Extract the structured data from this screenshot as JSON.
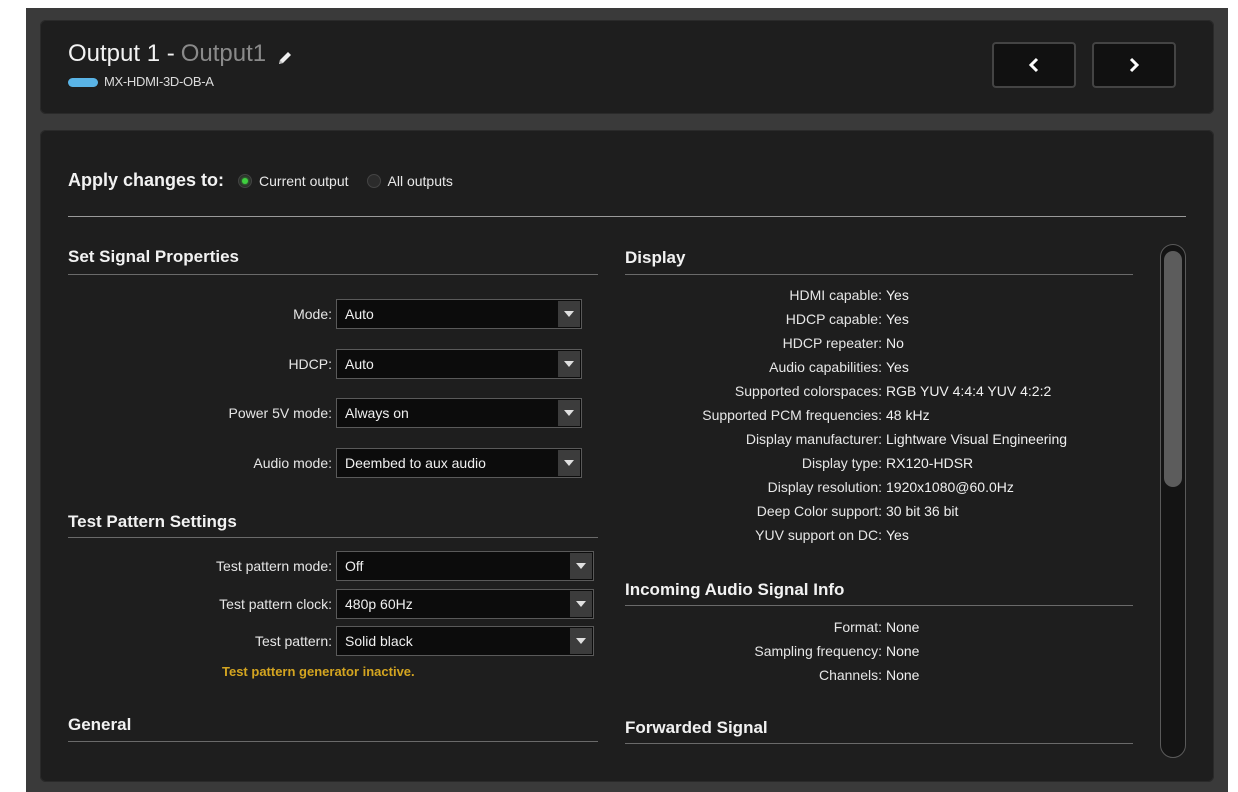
{
  "header": {
    "title_prefix": "Output 1 -",
    "output_name": "Output1",
    "device_model": "MX-HDMI-3D-OB-A"
  },
  "apply": {
    "label": "Apply changes to:",
    "options": [
      "Current output",
      "All outputs"
    ],
    "selected": "Current output"
  },
  "signal": {
    "title": "Set Signal Properties",
    "rows": [
      {
        "label": "Mode:",
        "value": "Auto"
      },
      {
        "label": "HDCP:",
        "value": "Auto"
      },
      {
        "label": "Power 5V mode:",
        "value": "Always on"
      },
      {
        "label": "Audio mode:",
        "value": "Deembed to aux audio"
      }
    ]
  },
  "test_pattern": {
    "title": "Test Pattern Settings",
    "rows": [
      {
        "label": "Test pattern mode:",
        "value": "Off"
      },
      {
        "label": "Test pattern clock:",
        "value": "480p 60Hz"
      },
      {
        "label": "Test pattern:",
        "value": "Solid black"
      }
    ],
    "warning": "Test pattern generator inactive."
  },
  "general": {
    "title": "General"
  },
  "display": {
    "title": "Display",
    "rows": [
      {
        "key": "HDMI capable:",
        "value": "Yes"
      },
      {
        "key": "HDCP capable:",
        "value": "Yes"
      },
      {
        "key": "HDCP repeater:",
        "value": "No"
      },
      {
        "key": "Audio capabilities:",
        "value": "Yes"
      },
      {
        "key": "Supported colorspaces:",
        "value": "RGB YUV 4:4:4 YUV 4:2:2"
      },
      {
        "key": "Supported PCM frequencies:",
        "value": "48 kHz"
      },
      {
        "key": "Display manufacturer:",
        "value": "Lightware Visual Engineering"
      },
      {
        "key": "Display type:",
        "value": "RX120-HDSR"
      },
      {
        "key": "Display resolution:",
        "value": "1920x1080@60.0Hz"
      },
      {
        "key": "Deep Color support:",
        "value": "30 bit 36 bit"
      },
      {
        "key": "YUV support on DC:",
        "value": "Yes"
      }
    ]
  },
  "audio_info": {
    "title": "Incoming Audio Signal Info",
    "rows": [
      {
        "key": "Format:",
        "value": "None"
      },
      {
        "key": "Sampling frequency:",
        "value": "None"
      },
      {
        "key": "Channels:",
        "value": "None"
      }
    ]
  },
  "forwarded": {
    "title": "Forwarded Signal"
  },
  "colors": {
    "accent_green": "#3fcf3f",
    "warning": "#d4a520",
    "device_pill": "#5ab4e6",
    "panel_bg": "#1e1e1e"
  },
  "icons": [
    "pencil-icon",
    "chevron-left-icon",
    "chevron-right-icon",
    "dropdown-arrow-icon"
  ]
}
